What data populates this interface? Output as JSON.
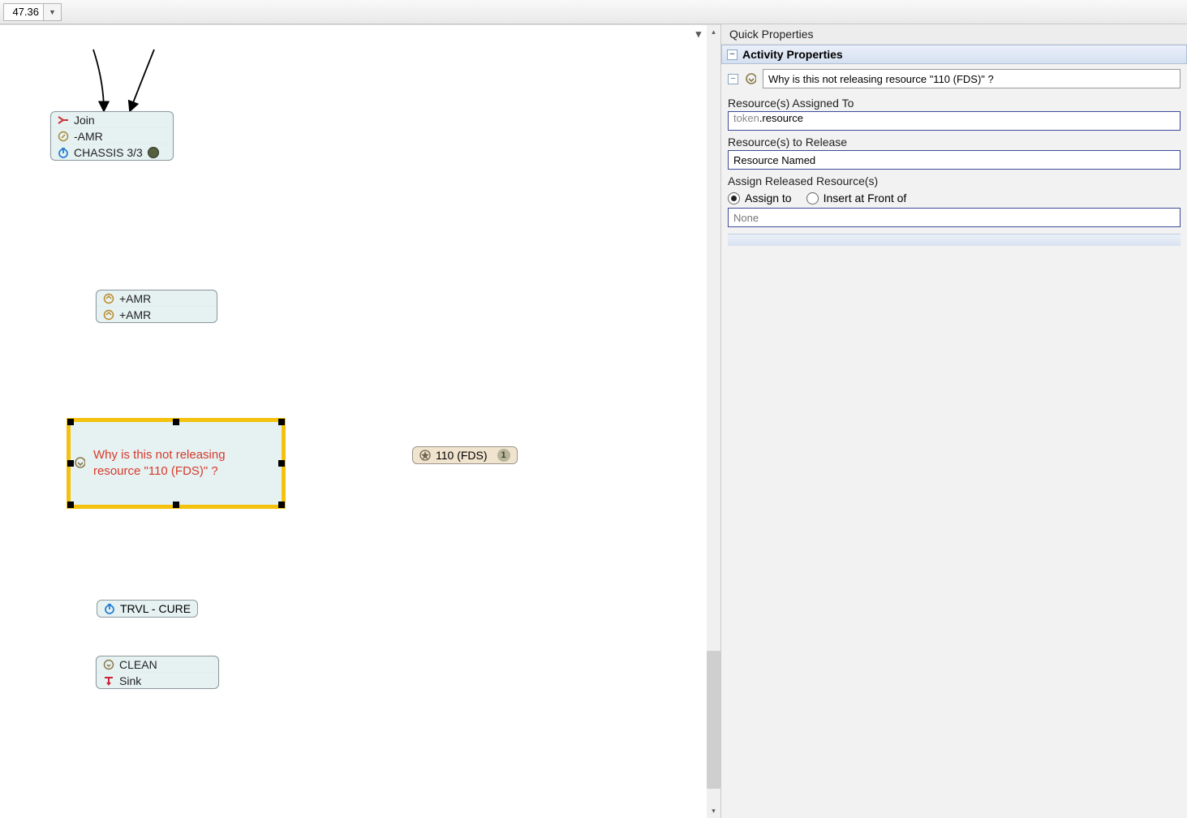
{
  "toolbar": {
    "value": "47.36"
  },
  "canvas": {
    "nodes": {
      "join": {
        "line1": "Join",
        "line2": "-AMR",
        "line3": "CHASSIS 3/3"
      },
      "amr": {
        "line1": "+AMR",
        "line2": "+AMR"
      },
      "selected": {
        "text": "Why is this not releasing\nresource \"110 (FDS)\" ?"
      },
      "resource": {
        "label": "110 (FDS)",
        "count": "1"
      },
      "trvl": {
        "label": "TRVL - CURE"
      },
      "clean": {
        "line1": "CLEAN",
        "line2": "Sink"
      }
    }
  },
  "properties": {
    "panelTitle": "Quick Properties",
    "sectionTitle": "Activity Properties",
    "nameValue": "Why is this not releasing resource \"110 (FDS)\" ?",
    "resourcesAssignedLabel": "Resource(s) Assigned To",
    "resourcesAssignedValueA": "token",
    "resourcesAssignedValueB": ".resource",
    "resourcesReleaseLabel": "Resource(s) to Release",
    "resourcesReleaseValue": "Resource Named",
    "assignReleasedLabel": "Assign Released Resource(s)",
    "radioAssign": "Assign to",
    "radioInsert": "Insert at Front of",
    "assignTargetValue": "None"
  }
}
